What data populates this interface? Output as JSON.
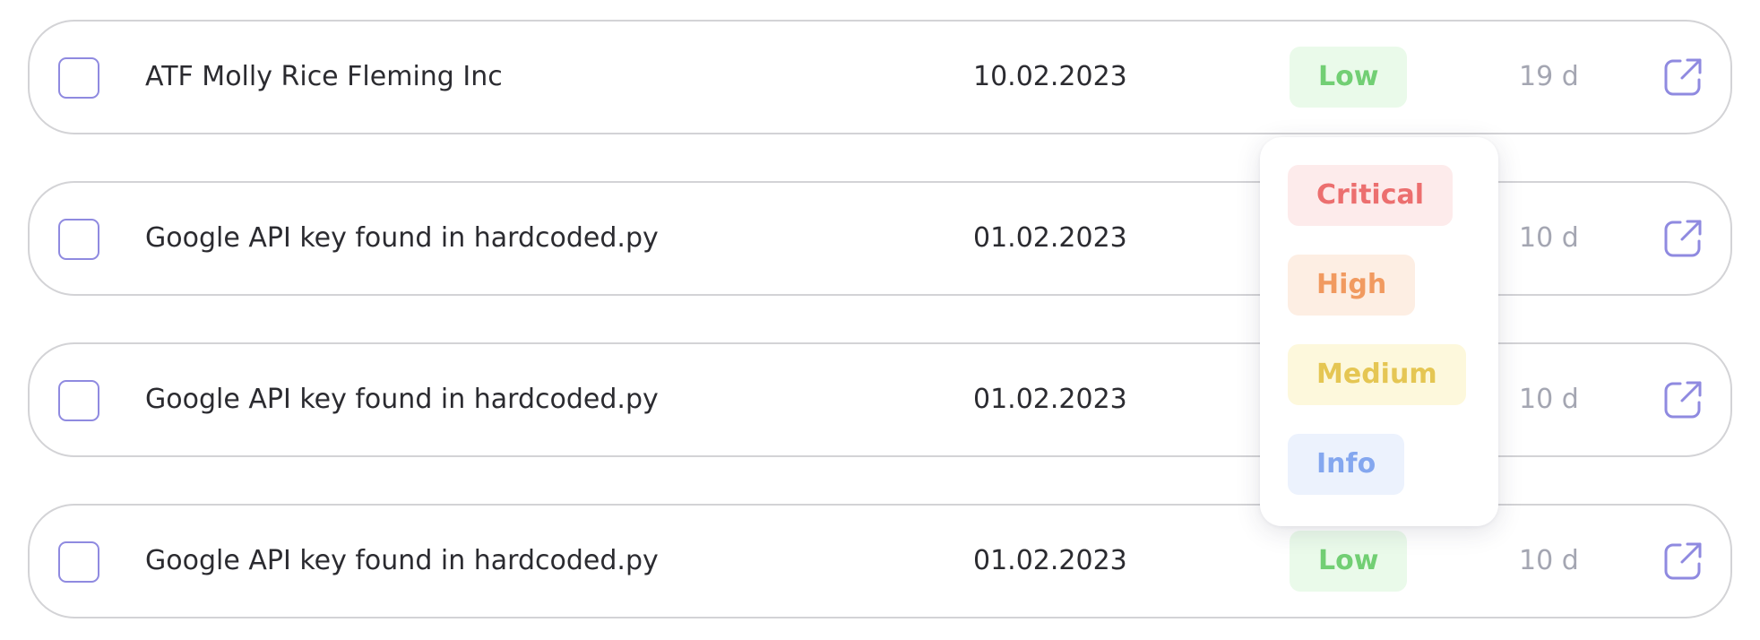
{
  "rows": [
    {
      "title": "ATF Molly Rice Fleming Inc",
      "date": "10.02.2023",
      "severity": "Low",
      "age": "19 d"
    },
    {
      "title": "Google API key found in hardcoded.py",
      "date": "01.02.2023",
      "severity": "",
      "age": "10 d"
    },
    {
      "title": "Google API key found in hardcoded.py",
      "date": "01.02.2023",
      "severity": "",
      "age": "10 d"
    },
    {
      "title": "Google API key found in hardcoded.py",
      "date": "01.02.2023",
      "severity": "Low",
      "age": "10 d"
    }
  ],
  "severity_menu": {
    "options": [
      "Critical",
      "High",
      "Medium",
      "Info"
    ]
  },
  "colors": {
    "low_text": "#72cf74",
    "low_bg": "#eafaea",
    "critical_text": "#ec6f6f",
    "critical_bg": "#fdebeb",
    "high_text": "#f19a60",
    "high_bg": "#fdeee3",
    "medium_text": "#e5c653",
    "medium_bg": "#fdf8dc",
    "info_text": "#84a7ef",
    "info_bg": "#ecf2fd",
    "accent": "#8f8ae0"
  },
  "icons": {
    "checkbox": "checkbox-unchecked",
    "open": "external-link-icon"
  }
}
